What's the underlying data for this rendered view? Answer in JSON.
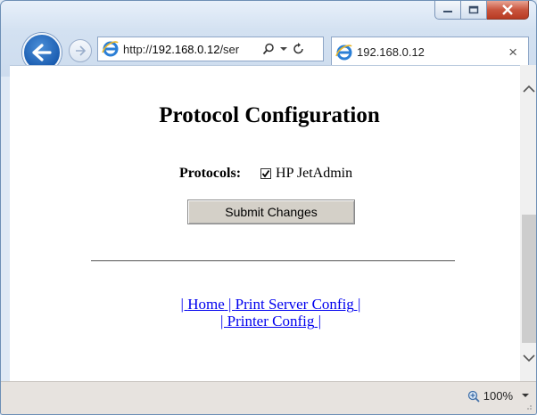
{
  "browser": {
    "url": "http://192.168.0.12/ser",
    "url_host": "192.168.0.12",
    "url_prefix": "http://",
    "url_suffix": "/ser",
    "tab_title": "192.168.0.12",
    "tab_close": "×",
    "zoom": "100%"
  },
  "page": {
    "title": "Protocol Configuration",
    "protocols_label": "Protocols:",
    "protocol_option": "HP JetAdmin",
    "protocol_checked": true,
    "submit_label": "Submit Changes",
    "links": {
      "sep1": "| ",
      "home": "Home",
      "sep2": " | ",
      "print_server": "Print Server Config",
      "sep3": " |",
      "sep4": "| ",
      "printer": "Printer Config",
      "sep5": " |"
    }
  },
  "colors": {
    "link": "#0000ee",
    "back_button": "#1a5cb0",
    "close_button": "#c9553e"
  }
}
